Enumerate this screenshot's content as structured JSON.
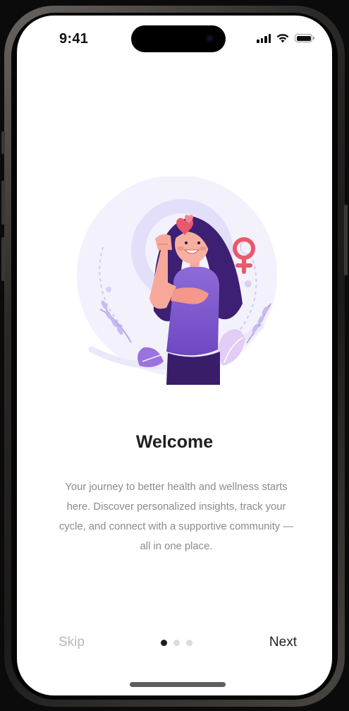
{
  "status_bar": {
    "time": "9:41",
    "battery_icon": "battery-icon",
    "wifi_icon": "wifi-icon",
    "signal_icon": "cellular-signal-icon"
  },
  "onboarding": {
    "illustration": "woman-flexing-arm-with-female-symbol-illustration",
    "title": "Welcome",
    "description": "Your journey to better health and wellness starts here. Discover personalized insights, track your cycle, and connect with a supportive community —all in one place.",
    "current_page": 1,
    "total_pages": 3
  },
  "footer": {
    "skip_label": "Skip",
    "next_label": "Next"
  },
  "colors": {
    "accent": "#7b52c9",
    "heart": "#e85a6b",
    "text": "#1e1e22",
    "muted": "#8a8a90"
  }
}
